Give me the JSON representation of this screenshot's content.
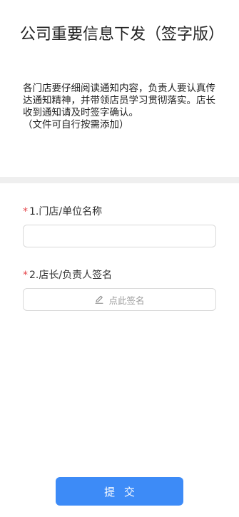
{
  "form": {
    "title": "公司重要信息下发（签字版）",
    "description_lines": [
      "各门店要仔细阅读通知内容，负责人要认真传达通知精神，并带领店员学习贯彻落实。店长收到通知请及时签字确认。",
      "（文件可自行按需添加）"
    ]
  },
  "fields": [
    {
      "required_mark": "*",
      "label": "1.门店/单位名称",
      "value": "",
      "placeholder": ""
    },
    {
      "required_mark": "*",
      "label": "2.店长/负责人签名",
      "action_icon": "pen-icon",
      "action_text": "点此签名"
    }
  ],
  "submit": {
    "label": "提 交"
  },
  "colors": {
    "primary": "#3d8bf7",
    "required": "#e5484d",
    "divider": "#efefef",
    "border": "#d9d9d9",
    "placeholder_text": "#9a9a9a"
  }
}
